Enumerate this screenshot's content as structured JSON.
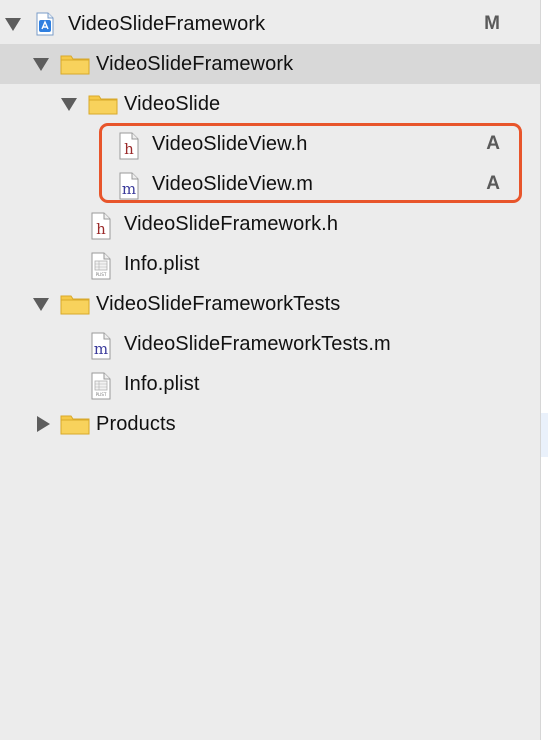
{
  "navigator": {
    "rows": [
      {
        "label": "VideoSlideFramework",
        "kind": "project",
        "badge": "M",
        "expanded": true
      },
      {
        "label": "VideoSlideFramework",
        "kind": "folder",
        "expanded": true,
        "selected": true
      },
      {
        "label": "VideoSlide",
        "kind": "folder",
        "expanded": true
      },
      {
        "label": "VideoSlideView.h",
        "kind": "header-file",
        "icon_letter": "h",
        "badge": "A",
        "highlighted": true
      },
      {
        "label": "VideoSlideView.m",
        "kind": "source-file",
        "icon_letter": "m",
        "badge": "A",
        "highlighted": true
      },
      {
        "label": "VideoSlideFramework.h",
        "kind": "header-file",
        "icon_letter": "h"
      },
      {
        "label": "Info.plist",
        "kind": "plist-file",
        "icon_letter": "PLIST"
      },
      {
        "label": "VideoSlideFrameworkTests",
        "kind": "folder",
        "expanded": true
      },
      {
        "label": "VideoSlideFrameworkTests.m",
        "kind": "source-file",
        "icon_letter": "m"
      },
      {
        "label": "Info.plist",
        "kind": "plist-file",
        "icon_letter": "PLIST"
      },
      {
        "label": "Products",
        "kind": "folder",
        "expanded": false
      }
    ]
  },
  "colors": {
    "highlight_border": "#e8552b",
    "selected_row": "#d8d8d8",
    "folder": "#f6c948",
    "header_letter": "#9b2a2a",
    "source_letter": "#3b3b9b",
    "badge": "#5a5a5a"
  }
}
